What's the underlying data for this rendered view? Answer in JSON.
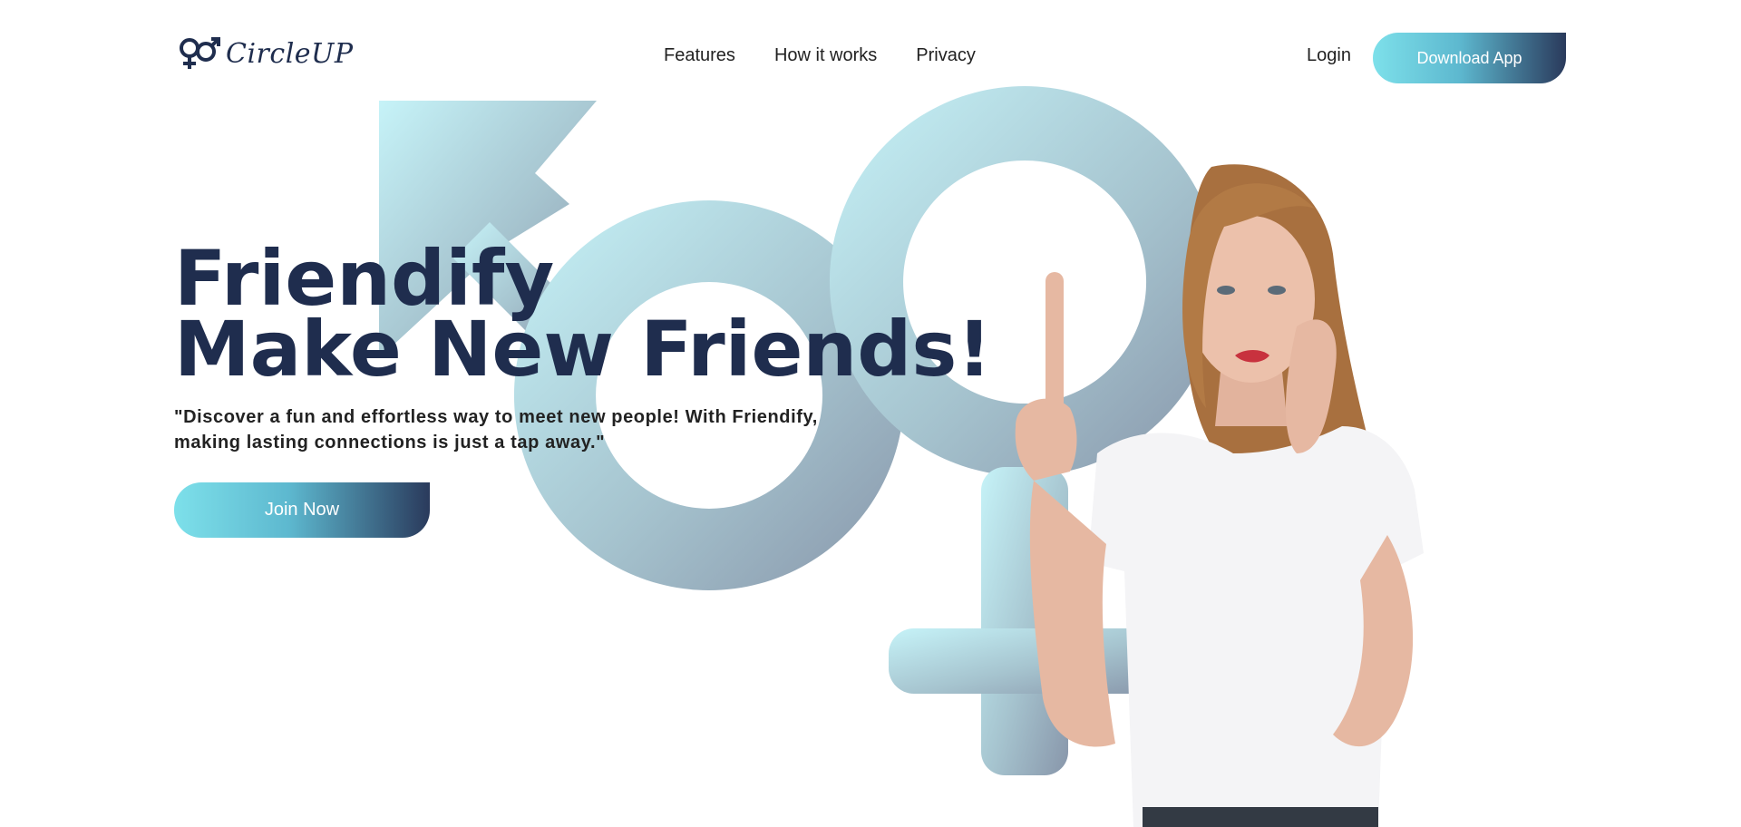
{
  "brand": {
    "logo_text": "CircleUP",
    "logo_icon": "gender-symbols-icon"
  },
  "nav": {
    "items": [
      {
        "label": "Features"
      },
      {
        "label": "How it works"
      },
      {
        "label": "Privacy"
      }
    ],
    "login_label": "Login",
    "download_label": "Download App"
  },
  "hero": {
    "title_line1": "Friendify",
    "title_line2": "Make New Friends!",
    "description": "\"Discover a fun and effortless way to meet new people! With Friendify, making lasting connections is just a tap away.\"",
    "join_label": "Join Now"
  },
  "colors": {
    "brand_navy": "#1f2d4e",
    "gradient_start": "#7de0ea",
    "gradient_end": "#2a3a5c",
    "symbol_light": "#c4f1f6",
    "symbol_dark": "#8ea0b2"
  }
}
